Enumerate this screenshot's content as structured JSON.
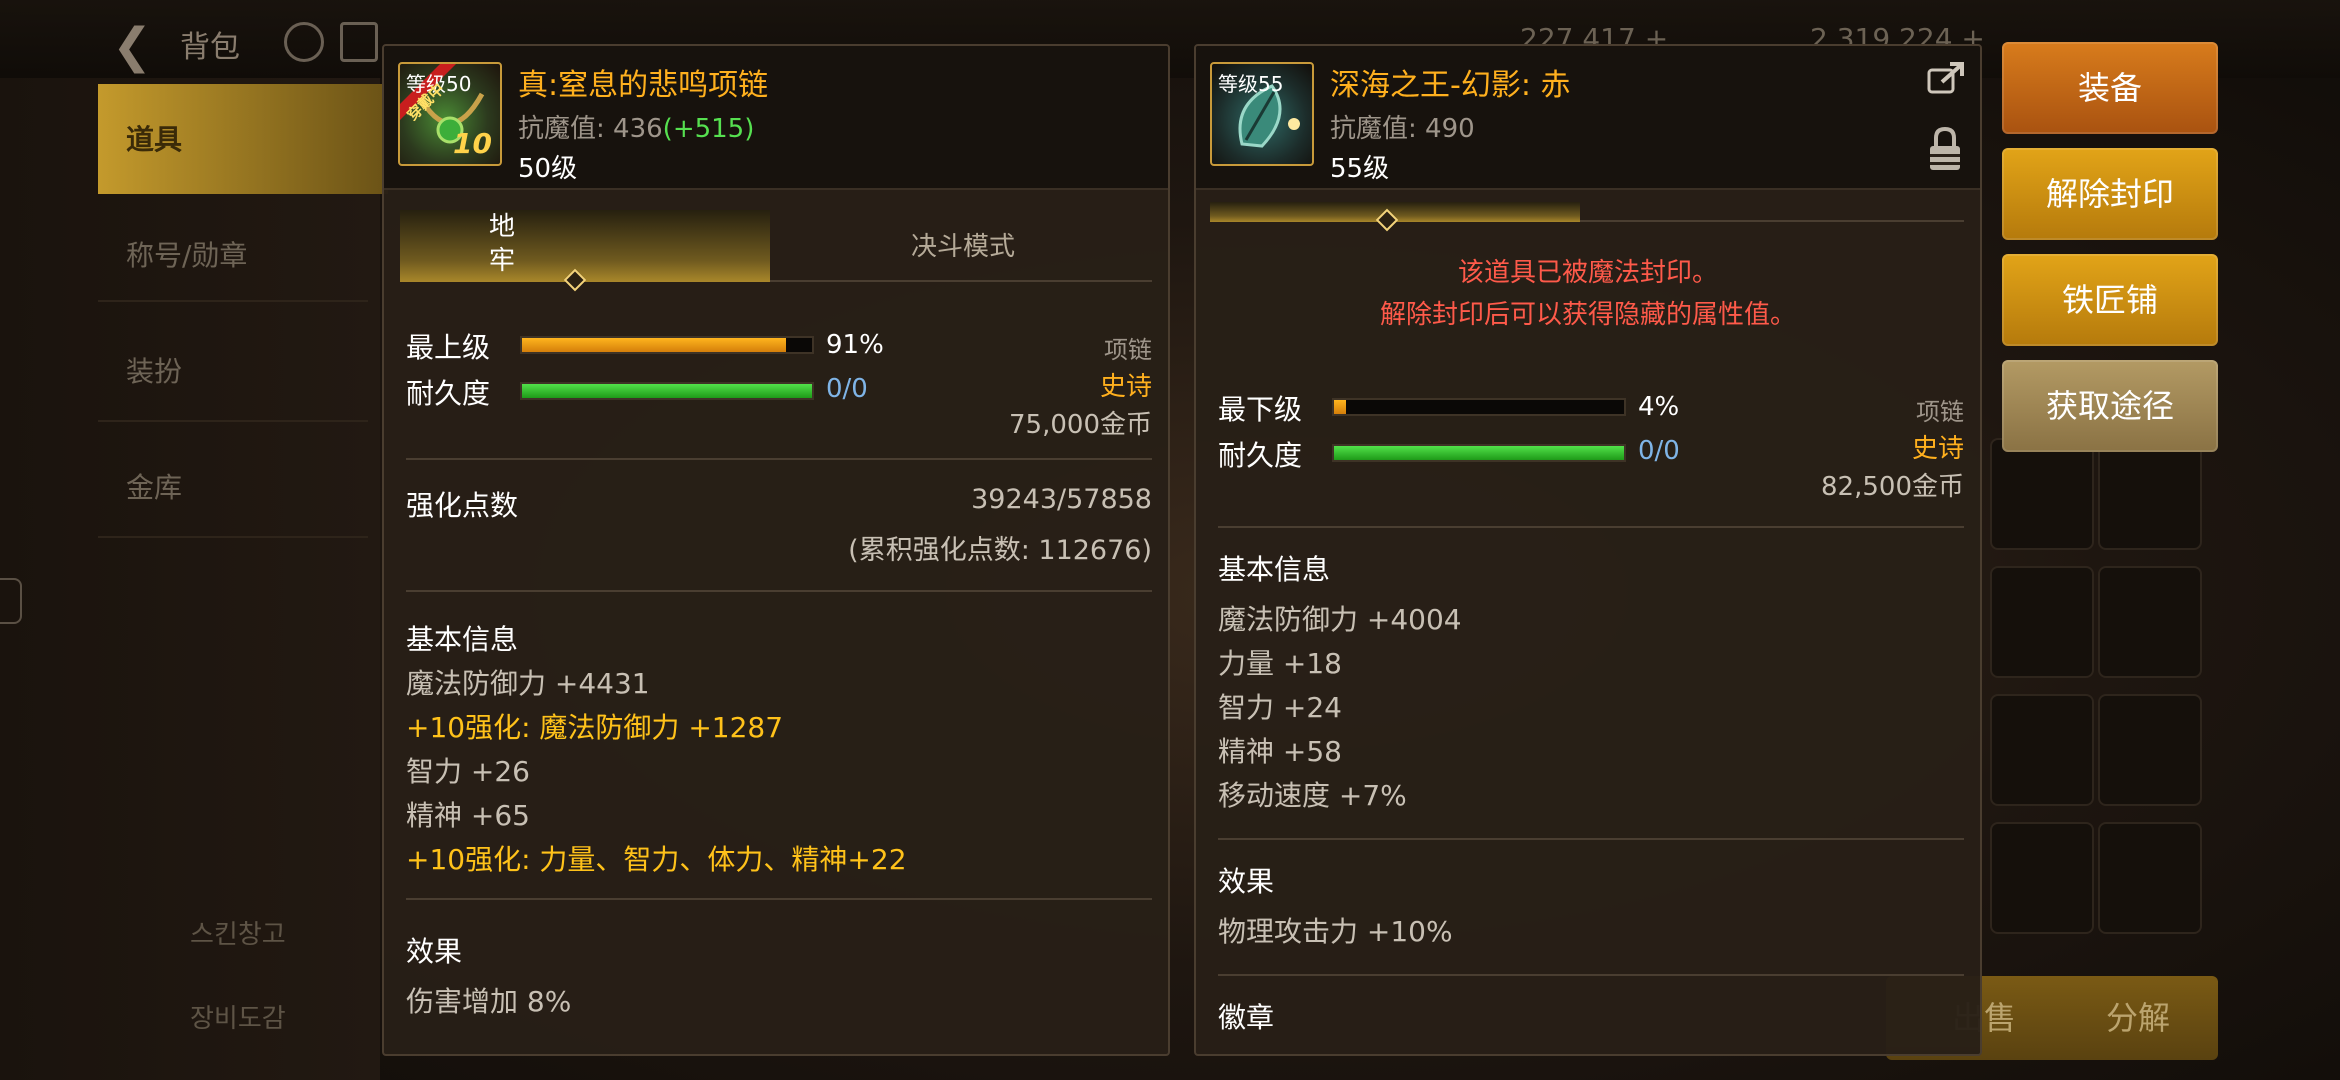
{
  "background": {
    "back_label": "背包",
    "currency_1": "227,417 +",
    "currency_2": "2,319,224 +",
    "sidebar": [
      "道具",
      "称号/勋章",
      "装扮",
      "金库"
    ],
    "sidebar_bottom": [
      "스킨창고",
      "장비도감"
    ],
    "bottom_buttons": [
      "出售",
      "分解"
    ]
  },
  "left_panel": {
    "badge_level": "等级50",
    "badge_wearing": "穿戴中",
    "badge_plus": "10",
    "name": "真:窒息的悲鸣项链",
    "resist_label": "抗魔值:",
    "resist_value": "436",
    "resist_bonus": "(+515)",
    "level": "50级",
    "tabs": [
      "地牢",
      "决斗模式"
    ],
    "grade_label": "最上级",
    "grade_pct": "91%",
    "grade_value": 0.91,
    "durability_label": "耐久度",
    "durability_value": "0/0",
    "slot": "项链",
    "rarity": "史诗",
    "price": "75,000金币",
    "reinforce_label": "强化点数",
    "reinforce_value": "39243/57858",
    "reinforce_total": "(累积强化点数: 112676)",
    "basic_title": "基本信息",
    "stats": [
      {
        "text": "魔法防御力 +4431",
        "gold": false
      },
      {
        "text": "+10强化: 魔法防御力 +1287",
        "gold": true
      },
      {
        "text": "智力 +26",
        "gold": false
      },
      {
        "text": "精神 +65",
        "gold": false
      },
      {
        "text": "+10强化: 力量、智力、体力、精神+22",
        "gold": true
      }
    ],
    "effect_title": "效果",
    "effect": "伤害增加 8%"
  },
  "right_panel": {
    "badge_level": "等级55",
    "name": "深海之王-幻影: 赤",
    "resist_label": "抗魔值:",
    "resist_value": "490",
    "level": "55级",
    "seal_line1": "该道具已被魔法封印。",
    "seal_line2": "解除封印后可以获得隐藏的属性值。",
    "grade_label": "最下级",
    "grade_pct": "4%",
    "grade_value": 0.04,
    "durability_label": "耐久度",
    "durability_value": "0/0",
    "slot": "项链",
    "rarity": "史诗",
    "price": "82,500金币",
    "basic_title": "基本信息",
    "stats": [
      "魔法防御力 +4004",
      "力量 +18",
      "智力 +24",
      "精神 +58",
      "移动速度 +7%"
    ],
    "effect_title": "效果",
    "effect": "物理攻击力 +10%",
    "emblem_title": "徽章"
  },
  "actions": {
    "equip": "装备",
    "unseal": "解除封印",
    "smith": "铁匠铺",
    "source": "获取途径"
  },
  "colors": {
    "epic": "#ffb01e",
    "equip_btn": "#c8701a",
    "gold_btn": "#d49a12",
    "source_btn": "#a08a5a"
  }
}
